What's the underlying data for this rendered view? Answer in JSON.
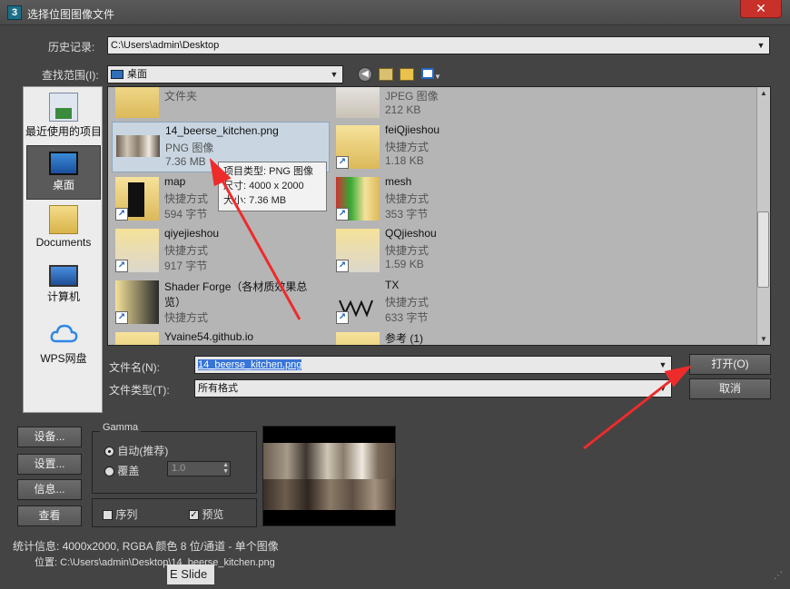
{
  "window": {
    "title": "选择位图图像文件",
    "close_glyph": "✕"
  },
  "history": {
    "label": "历史记录:",
    "value": "C:\\Users\\admin\\Desktop"
  },
  "lookin": {
    "label": "查找范围(I):",
    "value": "桌面"
  },
  "toolbar": {
    "back": "back-icon",
    "up": "up-folder-icon",
    "new": "new-folder-icon",
    "view": "view-menu-icon"
  },
  "places": [
    {
      "label": "最近使用的项目",
      "icon": "recent-icon"
    },
    {
      "label": "桌面",
      "icon": "desktop-icon"
    },
    {
      "label": "Documents",
      "icon": "documents-icon"
    },
    {
      "label": "计算机",
      "icon": "computer-icon"
    },
    {
      "label": "WPS网盘",
      "icon": "cloud-icon"
    }
  ],
  "files": [
    {
      "name": "",
      "type": "文件夹",
      "size": ""
    },
    {
      "name": "",
      "type": "JPEG 图像",
      "size": "212 KB"
    },
    {
      "name": "14_beerse_kitchen.png",
      "type": "PNG 图像",
      "size": "7.36 MB"
    },
    {
      "name": "feiQjieshou",
      "type": "快捷方式",
      "size": "1.18 KB"
    },
    {
      "name": "map",
      "type": "快捷方式",
      "size": "594 字节"
    },
    {
      "name": "mesh",
      "type": "快捷方式",
      "size": "353 字节"
    },
    {
      "name": "qiyejieshou",
      "type": "快捷方式",
      "size": "917 字节"
    },
    {
      "name": "QQjieshou",
      "type": "快捷方式",
      "size": "1.59 KB"
    },
    {
      "name": "Shader Forge（各材质效果总",
      "name2": "览）",
      "type": "快捷方式",
      "size": ""
    },
    {
      "name": "TX",
      "type": "快捷方式",
      "size": "633 字节"
    },
    {
      "name": "Yvaine54.github.io",
      "type": "",
      "size": ""
    },
    {
      "name": "参考 (1)",
      "type": "",
      "size": ""
    }
  ],
  "tooltip": {
    "line1": "项目类型: PNG 图像",
    "line2": "尺寸: 4000 x 2000",
    "line3": "大小: 7.36 MB"
  },
  "filename": {
    "label": "文件名(N):",
    "value": "14_beerse_kitchen.png"
  },
  "filetype": {
    "label": "文件类型(T):",
    "value": "所有格式"
  },
  "buttons": {
    "open": "打开(O)",
    "cancel": "取消",
    "setup1": "设备...",
    "setup2": "设置...",
    "info": "信息...",
    "view": "查看"
  },
  "gamma": {
    "title": "Gamma",
    "auto": "自动(推荐)",
    "override": "覆盖",
    "override_value": "1.0"
  },
  "options": {
    "sequence": "序列",
    "preview": "预览"
  },
  "stats": {
    "label": "统计信息:",
    "value": "4000x2000, RGBA 颜色 8 位/通道 - 单个图像"
  },
  "location": {
    "label": "位置:",
    "value": "C:\\Users\\admin\\Desktop\\14_beerse_kitchen.png",
    "overlay": "E Slide"
  }
}
